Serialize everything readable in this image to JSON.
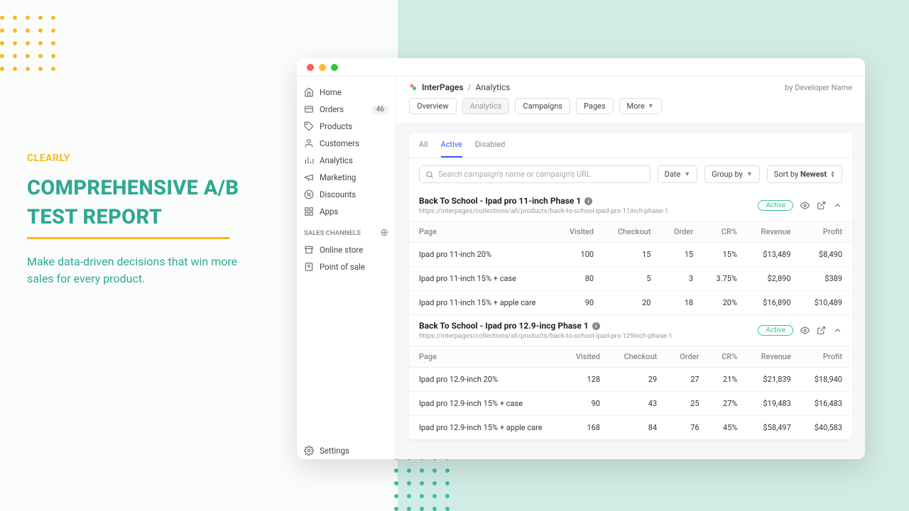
{
  "marketing": {
    "eyebrow": "CLEARLY",
    "headline": "COMPREHENSIVE A/B TEST REPORT",
    "sub": "Make data-driven decisions that win more sales for every product."
  },
  "sidebar": {
    "items": [
      {
        "icon": "home",
        "label": "Home"
      },
      {
        "icon": "orders",
        "label": "Orders",
        "badge": "46"
      },
      {
        "icon": "products",
        "label": "Products"
      },
      {
        "icon": "customers",
        "label": "Customers"
      },
      {
        "icon": "analytics",
        "label": "Analytics"
      },
      {
        "icon": "marketing",
        "label": "Marketing"
      },
      {
        "icon": "discounts",
        "label": "Discounts"
      },
      {
        "icon": "apps",
        "label": "Apps"
      }
    ],
    "section_label": "SALES CHANNELS",
    "channels": [
      {
        "icon": "store",
        "label": "Online store"
      },
      {
        "icon": "pos",
        "label": "Point of sale"
      }
    ],
    "settings": "Settings"
  },
  "header": {
    "brand": "InterPages",
    "page": "Analytics",
    "byline": "by Developer Name"
  },
  "subnav": [
    "Overview",
    "Analytics",
    "Campaigns",
    "Pages",
    "More"
  ],
  "tabs": [
    "All",
    "Active",
    "Disabled"
  ],
  "filters": {
    "search_placeholder": "Search campaign's name or campaign's URL",
    "date": "Date",
    "group": "Group by",
    "sort_prefix": "Sort by ",
    "sort_value": "Newest"
  },
  "columns": [
    "Page",
    "Visited",
    "Checkout",
    "Order",
    "CR%",
    "Revenue",
    "Profit"
  ],
  "campaigns": [
    {
      "title": "Back To School - Ipad pro 11-inch Phase 1",
      "url": "https://interpages/collections/all/products/back-to-school-ipad-pro-11inch-phase-1",
      "status": "Active",
      "rows": [
        {
          "page": "Ipad pro 11-inch 20%",
          "visited": "100",
          "checkout": "15",
          "order": "15",
          "cr": "15%",
          "revenue": "$13,489",
          "profit": "$8,490"
        },
        {
          "page": "Ipad pro 11-inch 15% + case",
          "visited": "80",
          "checkout": "5",
          "order": "3",
          "cr": "3.75%",
          "revenue": "$2,890",
          "profit": "$389"
        },
        {
          "page": "Ipad pro 11-inch 15% + apple care",
          "visited": "90",
          "checkout": "20",
          "order": "18",
          "cr": "20%",
          "revenue": "$16,890",
          "profit": "$10,489"
        }
      ]
    },
    {
      "title": "Back To School - Ipad pro 12.9-incg Phase 1",
      "url": "https://interpages/collections/all/products/back-to-school-ipad-pro-129inch-phase-1",
      "status": "Active",
      "rows": [
        {
          "page": "Ipad pro 12.9-inch 20%",
          "visited": "128",
          "checkout": "29",
          "order": "27",
          "cr": "21%",
          "revenue": "$21,839",
          "profit": "$18,940"
        },
        {
          "page": "Ipad pro 12.9-inch 15% + case",
          "visited": "90",
          "checkout": "43",
          "order": "25",
          "cr": "27%",
          "revenue": "$19,483",
          "profit": "$16,483"
        },
        {
          "page": "Ipad pro 12.9-inch 15% + apple care",
          "visited": "168",
          "checkout": "84",
          "order": "76",
          "cr": "45%",
          "revenue": "$58,497",
          "profit": "$40,583"
        }
      ]
    }
  ]
}
